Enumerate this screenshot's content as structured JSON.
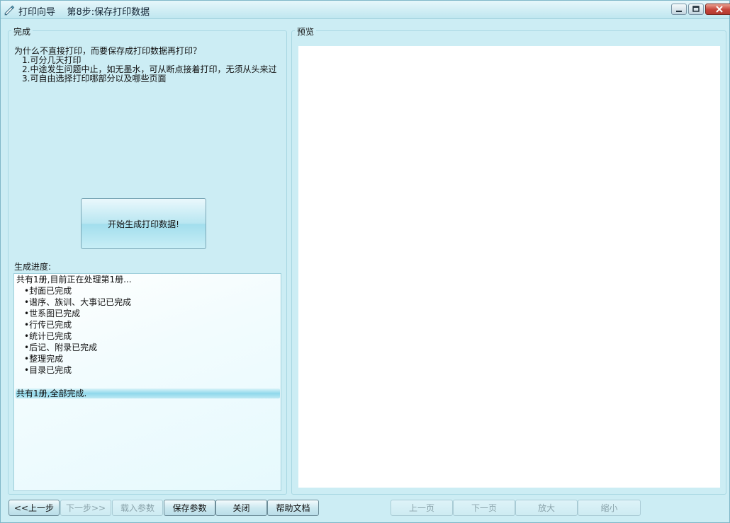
{
  "window": {
    "title": "打印向导    第8步:保存打印数据"
  },
  "left_panel": {
    "group_label": "完成",
    "question": "为什么不直接打印，而要保存成打印数据再打印？",
    "reasons": [
      "1.可分几天打印",
      "2.中途发生问题中止，如无墨水，可从断点接着打印，无须从头来过",
      "3.可自由选择打印哪部分以及哪些页面"
    ],
    "start_button": "开始生成打印数据!",
    "progress_label": "生成进度:",
    "log_header": "共有1册,目前正在处理第1册...",
    "log_items": [
      "•封面已完成",
      "•谱序、族训、大事记已完成",
      "•世系图已完成",
      "•行传已完成",
      "•统计已完成",
      "•后记、附录已完成",
      "•整理完成",
      "•目录已完成"
    ],
    "log_footer": "共有1册,全部完成."
  },
  "right_panel": {
    "group_label": "预览"
  },
  "bottom_buttons": {
    "prev_step": "<<上一步",
    "next_step": "下一步>>",
    "load_params": "载入参数",
    "save_params": "保存参数",
    "close": "关闭",
    "help": "帮助文档",
    "prev_page": "上一页",
    "next_page": "下一页",
    "zoom_in": "放大",
    "zoom_out": "缩小"
  },
  "icons": {
    "app": "pen-icon",
    "minimize": "minimize-icon",
    "maximize": "maximize-icon",
    "close": "close-icon"
  }
}
